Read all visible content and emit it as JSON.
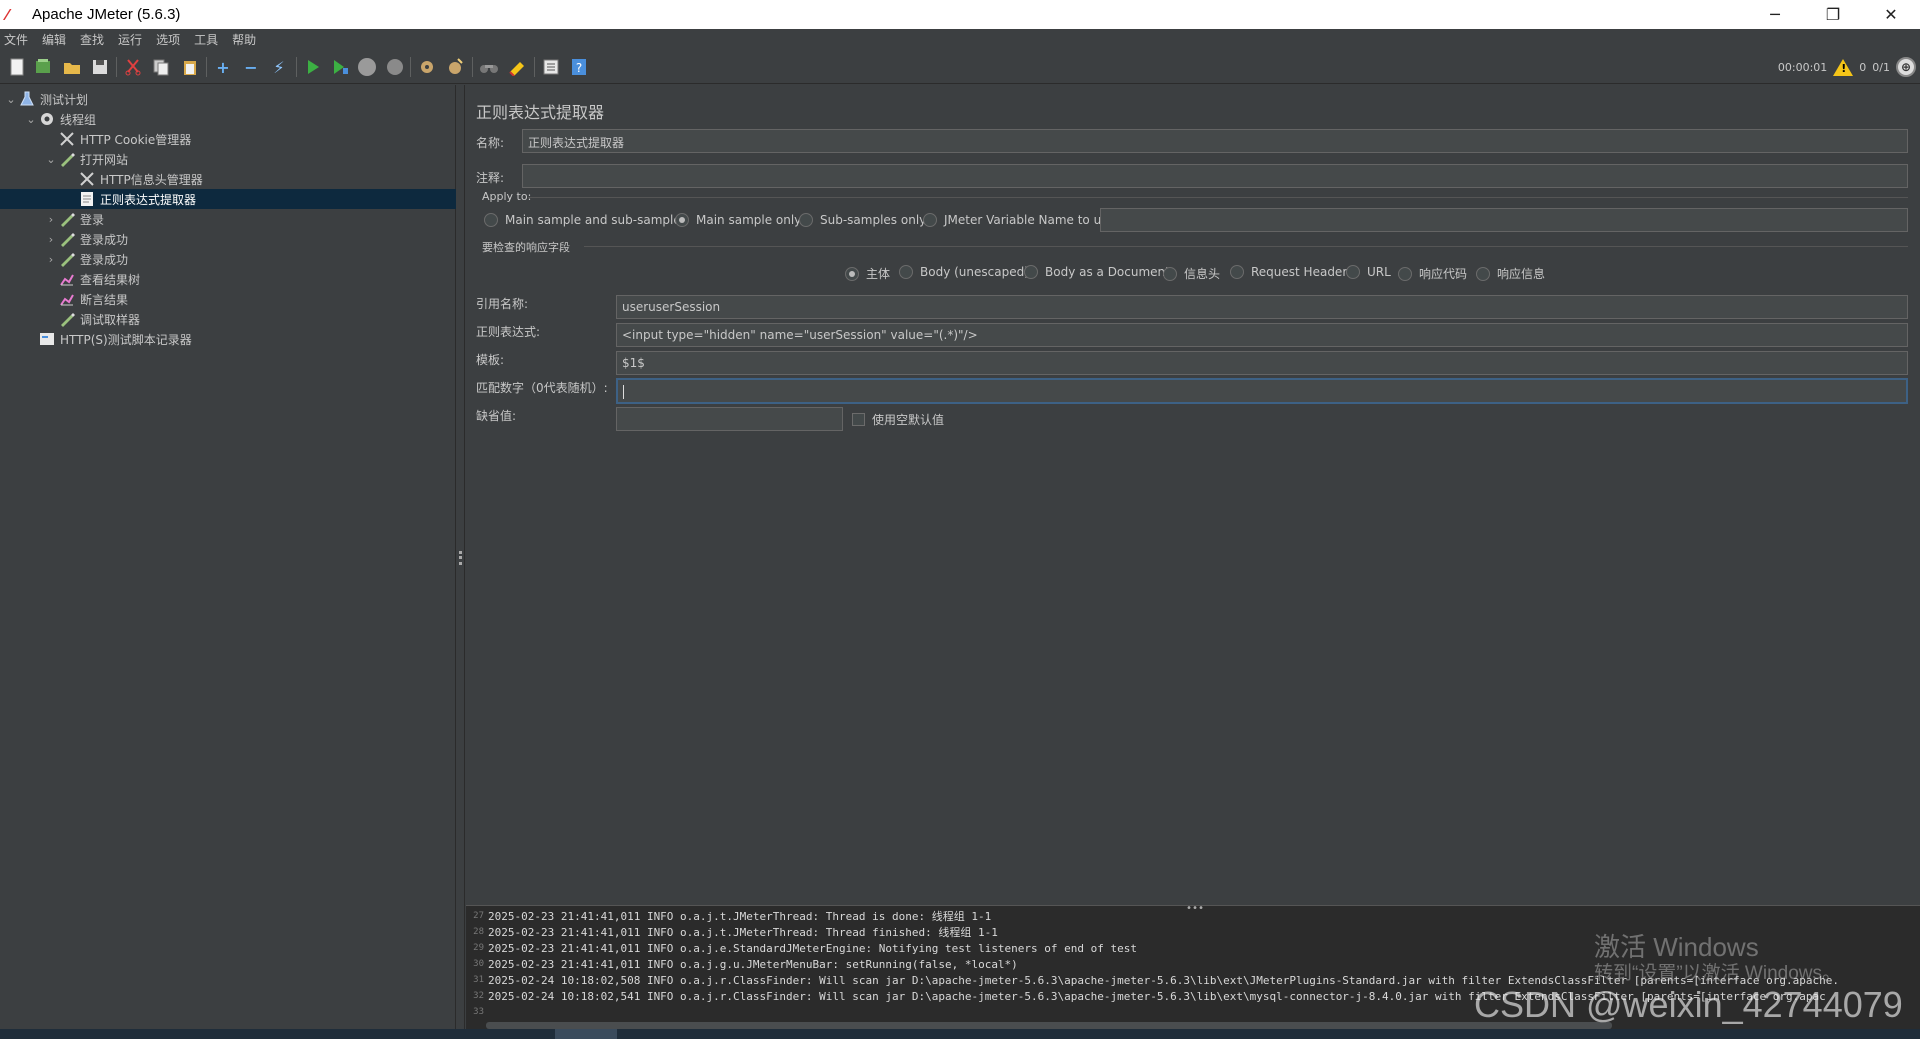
{
  "window": {
    "title": "Apache JMeter (5.6.3)",
    "minimize": "─",
    "restore": "❐",
    "close": "✕"
  },
  "menu": [
    "文件",
    "编辑",
    "查找",
    "运行",
    "选项",
    "工具",
    "帮助"
  ],
  "toolbar": {
    "buttons": [
      "new-icon",
      "templates-icon",
      "open-icon",
      "save-icon",
      "cut-icon",
      "copy-icon",
      "paste-icon",
      "expand-icon",
      "collapse-icon",
      "toggle-icon",
      "start-icon",
      "start-no-pause-icon",
      "stop-icon",
      "shutdown-icon",
      "clear-icon",
      "clear-all-icon",
      "search-icon",
      "reset-search-icon",
      "function-helper-icon",
      "help-icon"
    ],
    "elapsed_time": "00:00:01",
    "warning_count": "0",
    "threads": "0/1"
  },
  "tree": {
    "items": [
      {
        "label": "测试计划",
        "icon": "flask-icon",
        "indent": 0,
        "expanded": true
      },
      {
        "label": "线程组",
        "icon": "gear-icon",
        "indent": 1,
        "expanded": true
      },
      {
        "label": "HTTP Cookie管理器",
        "icon": "wrench-icon",
        "indent": 2
      },
      {
        "label": "打开网站",
        "icon": "pen-icon",
        "indent": 2,
        "expanded": true
      },
      {
        "label": "HTTP信息头管理器",
        "icon": "wrench-icon",
        "indent": 3
      },
      {
        "label": "正则表达式提取器",
        "icon": "document-icon",
        "indent": 3,
        "selected": true
      },
      {
        "label": "登录",
        "icon": "pen-icon",
        "indent": 2,
        "collapsed": true
      },
      {
        "label": "登录成功",
        "icon": "pen-icon",
        "indent": 2,
        "collapsed": true
      },
      {
        "label": "登录成功",
        "icon": "pen-icon",
        "indent": 2,
        "collapsed": true
      },
      {
        "label": "查看结果树",
        "icon": "chart-icon",
        "indent": 2
      },
      {
        "label": "断言结果",
        "icon": "chart-icon",
        "indent": 2
      },
      {
        "label": "调试取样器",
        "icon": "pen-icon",
        "indent": 2
      },
      {
        "label": "HTTP(S)测试脚本记录器",
        "icon": "recorder-icon",
        "indent": 1
      }
    ]
  },
  "form": {
    "panel_title": "正则表达式提取器",
    "name_label": "名称:",
    "name_value": "正则表达式提取器",
    "comment_label": "注释:",
    "comment_value": "",
    "apply_to_label": "Apply to:",
    "apply_options": [
      "Main sample and sub-samples",
      "Main sample only",
      "Sub-samples only",
      "JMeter Variable Name to use"
    ],
    "apply_selected": 1,
    "variable_name_value": "",
    "field_to_check_label": "要检查的响应字段",
    "field_options": [
      "主体",
      "Body (unescaped)",
      "Body as a Document",
      "信息头",
      "Request Headers",
      "URL",
      "响应代码",
      "响应信息"
    ],
    "field_selected": 0,
    "refname_label": "引用名称:",
    "refname_value": "useruserSession",
    "regex_label": "正则表达式:",
    "regex_value": "<input type=\"hidden\" name=\"userSession\" value=\"(.*)\"/>",
    "template_label": "模板:",
    "template_value": "$1$",
    "match_label": "匹配数字（0代表随机）:",
    "match_value": "",
    "default_label": "缺省值:",
    "default_value": "",
    "empty_default_label": "使用空默认值"
  },
  "log": {
    "lines": [
      {
        "n": "27",
        "text": "2025-02-23 21:41:41,011 INFO o.a.j.t.JMeterThread: Thread is done: 线程组 1-1"
      },
      {
        "n": "28",
        "text": "2025-02-23 21:41:41,011 INFO o.a.j.t.JMeterThread: Thread finished: 线程组 1-1"
      },
      {
        "n": "29",
        "text": "2025-02-23 21:41:41,011 INFO o.a.j.e.StandardJMeterEngine: Notifying test listeners of end of test"
      },
      {
        "n": "30",
        "text": "2025-02-23 21:41:41,011 INFO o.a.j.g.u.JMeterMenuBar: setRunning(false, *local*)"
      },
      {
        "n": "31",
        "text": "2025-02-24 10:18:02,508 INFO o.a.j.r.ClassFinder: Will scan jar D:\\apache-jmeter-5.6.3\\apache-jmeter-5.6.3\\lib\\ext\\JMeterPlugins-Standard.jar with filter ExtendsClassFilter [parents=[interface org.apache."
      },
      {
        "n": "32",
        "text": "2025-02-24 10:18:02,541 INFO o.a.j.r.ClassFinder: Will scan jar D:\\apache-jmeter-5.6.3\\apache-jmeter-5.6.3\\lib\\ext\\mysql-connector-j-8.4.0.jar with filter ExtendsClassFilter [parents=[interface org.apac"
      },
      {
        "n": "33",
        "text": ""
      }
    ]
  },
  "watermark": {
    "activate_title": "激活 Windows",
    "activate_sub": "转到“设置”以激活 Windows。",
    "csdn": "CSDN @weixin_42744079"
  },
  "colors": {
    "background": "#3c3f41",
    "selection": "#0d293e",
    "field_bg": "#45494a",
    "log_bg": "#2b2b2b",
    "warning": "#f5c518"
  }
}
